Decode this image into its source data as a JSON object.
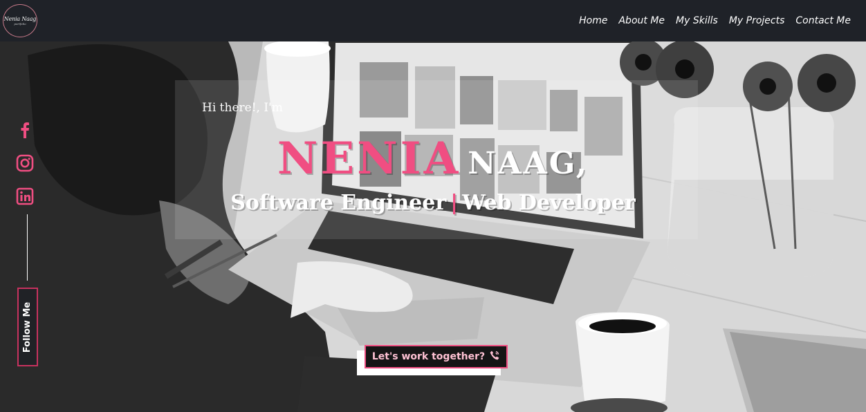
{
  "logo": {
    "main": "Nenia Naag",
    "sub": "portfolio"
  },
  "nav": [
    {
      "label": "Home"
    },
    {
      "label": "About Me"
    },
    {
      "label": "My Skills"
    },
    {
      "label": "My Projects"
    },
    {
      "label": "Contact Me"
    }
  ],
  "hero": {
    "greeting": "Hi there!, I'm",
    "first_name": "NENIA",
    "last_name": "NAAG,",
    "role_1": "Software Engineer",
    "role_separator": "|",
    "role_2": "Web Developer",
    "cta_label": "Let's work together?"
  },
  "social": {
    "icons": [
      "facebook-icon",
      "instagram-icon",
      "linkedin-icon"
    ],
    "follow_label": "Follow Me"
  },
  "colors": {
    "accent": "#f04e82",
    "nav_bg": "#1f2228",
    "cta_text": "#ffc2d4"
  }
}
